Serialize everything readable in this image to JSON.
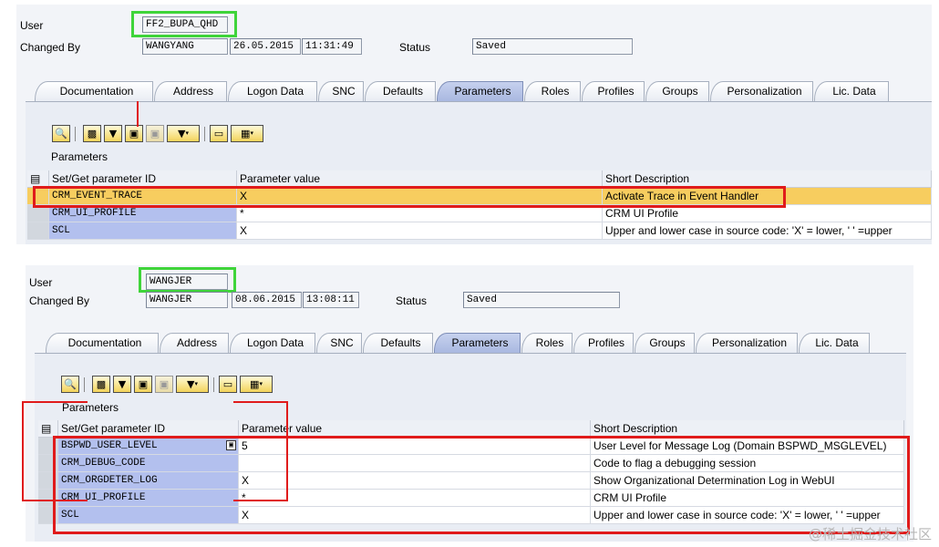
{
  "labels": {
    "user": "User",
    "changed_by": "Changed By",
    "status": "Status",
    "parameters_title": "Parameters"
  },
  "tabs": [
    "Documentation",
    "Address",
    "Logon Data",
    "SNC",
    "Defaults",
    "Parameters",
    "Roles",
    "Profiles",
    "Groups",
    "Personalization",
    "Lic. Data"
  ],
  "active_tab": "Parameters",
  "toolbar_icons": [
    "details-icon",
    "print-icon",
    "filter-icon",
    "find-icon",
    "find-next-icon",
    "set-filter-icon",
    "print-preview-icon",
    "spreadsheet-icon"
  ],
  "columns": [
    "Set/Get parameter ID",
    "Parameter value",
    "Short Description"
  ],
  "screen1": {
    "user": "FF2_BUPA_QHD",
    "changed_by": "WANGYANG",
    "date": "26.05.2015",
    "time": "11:31:49",
    "status": "Saved",
    "rows": [
      {
        "id": "CRM_EVENT_TRACE",
        "value": "X",
        "desc": "Activate Trace in Event Handler"
      },
      {
        "id": "CRM_UI_PROFILE",
        "value": "*",
        "desc": "CRM UI Profile"
      },
      {
        "id": "SCL",
        "value": "X",
        "desc": "Upper and lower case in source code: 'X' = lower, ' ' =upper"
      }
    ]
  },
  "screen2": {
    "user": "WANGJER",
    "changed_by": "WANGJER",
    "date": "08.06.2015",
    "time": "13:08:11",
    "status": "Saved",
    "rows": [
      {
        "id": "BSPWD_USER_LEVEL",
        "value": "5",
        "desc": "User Level for Message Log (Domain BSPWD_MSGLEVEL)"
      },
      {
        "id": "CRM_DEBUG_CODE",
        "value": "",
        "desc": "Code to flag a debugging session"
      },
      {
        "id": "CRM_ORGDETER_LOG",
        "value": "X",
        "desc": "Show Organizational Determination Log in WebUI"
      },
      {
        "id": "CRM_UI_PROFILE",
        "value": "*",
        "desc": "CRM UI Profile"
      },
      {
        "id": "SCL",
        "value": "X",
        "desc": "Upper and lower case in source code: 'X' = lower, ' ' =upper"
      }
    ]
  },
  "watermark": "@稀土掘金技术社区"
}
